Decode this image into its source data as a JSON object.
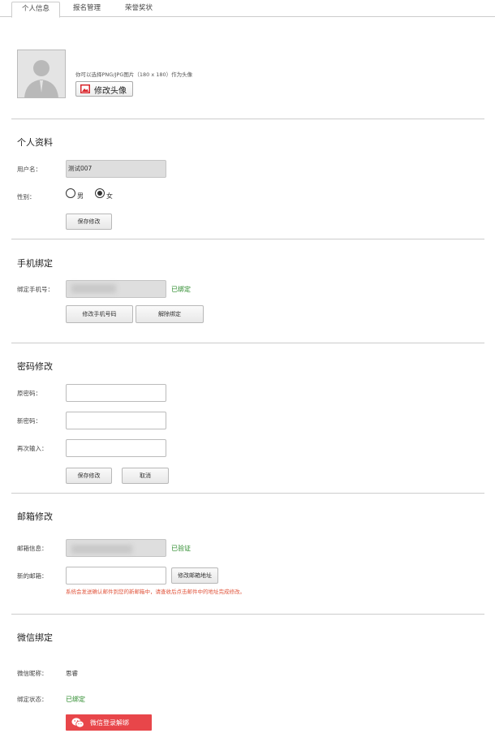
{
  "tabs": [
    {
      "label": "个人信息"
    },
    {
      "label": "报名管理"
    },
    {
      "label": "荣誉奖状"
    }
  ],
  "avatar": {
    "hint": "你可以选择PNG/JPG图片（180 x 180）作为头像",
    "change_label": "修改头像"
  },
  "profile": {
    "title": "个人资料",
    "username_label": "用户名：",
    "username_value": "测试007",
    "gender_label": "性别：",
    "male": "男",
    "female": "女",
    "selected": "女",
    "save_label": "保存修改"
  },
  "phone": {
    "title": "手机绑定",
    "label": "绑定手机号：",
    "status": "已绑定",
    "change_label": "修改手机号码",
    "unbind_label": "解除绑定"
  },
  "password": {
    "title": "密码修改",
    "old_label": "原密码：",
    "new_label": "新密码：",
    "confirm_label": "再次输入：",
    "save_label": "保存修改",
    "cancel_label": "取消"
  },
  "email": {
    "title": "邮箱修改",
    "info_label": "邮箱信息：",
    "status": "已验证",
    "new_label": "新的邮箱：",
    "change_label": "修改邮箱地址",
    "notice": "系统会发送确认邮件到您的新邮箱中，请查收后点击邮件中的地址完成修改。"
  },
  "wechat": {
    "title": "微信绑定",
    "nickname_label": "微信昵称：",
    "nickname_value": "思睿",
    "status_label": "绑定状态：",
    "status_value": "已绑定",
    "unbind_label": "微信登录解绑"
  },
  "colors": {
    "accent_red": "#e8464a",
    "status_green": "#2a8a2a",
    "notice_red": "#e0533a"
  }
}
